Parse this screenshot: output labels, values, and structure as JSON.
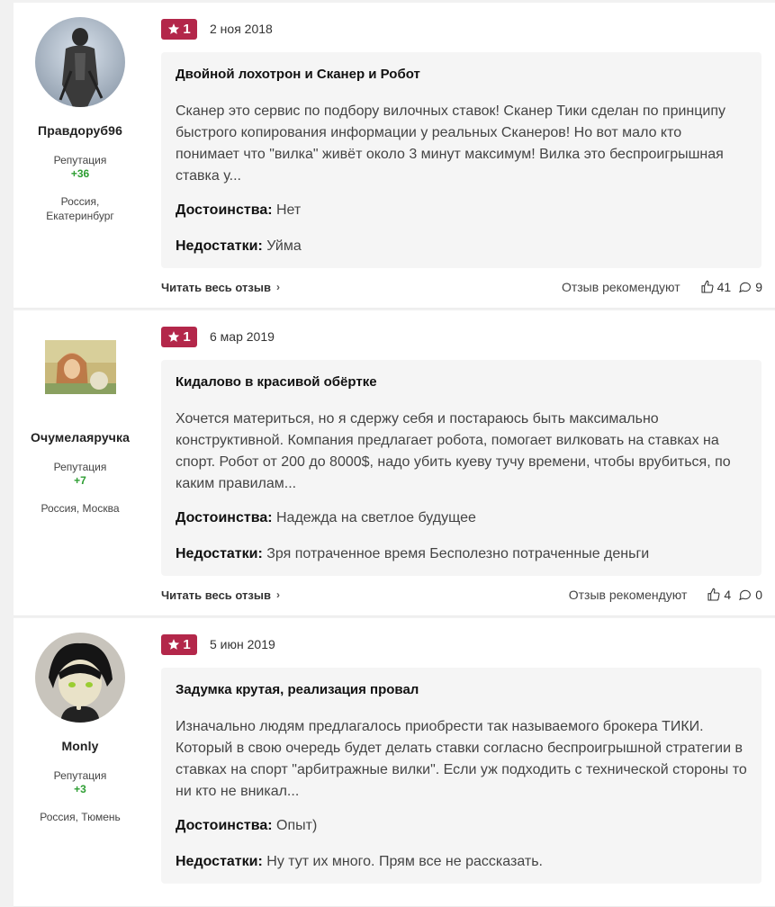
{
  "reviews": [
    {
      "username": "Правдоруб96",
      "reputation_label": "Репутация",
      "reputation_value": "+36",
      "location": "Россия, Екатеринбург",
      "rating": "1",
      "date": "2 ноя 2018",
      "title": "Двойной лохотрон и Сканер и Робот",
      "text": "Сканер это сервис по подбору вилочных ставок! Сканер Тики сделан по принципу быстрого копирования информации у реальных Сканеров! Но вот мало кто понимает что \"вилка\" живёт около 3 минут максимум! Вилка это беспроигрышная ставка у...",
      "pros_label": "Достоинства:",
      "pros": "Нет",
      "cons_label": "Недостатки:",
      "cons": "Уйма",
      "read_more": "Читать весь отзыв",
      "recommend_label": "Отзыв рекомендуют",
      "likes": "41",
      "comments": "9"
    },
    {
      "username": "Очумелаяручка",
      "reputation_label": "Репутация",
      "reputation_value": "+7",
      "location": "Россия, Москва",
      "rating": "1",
      "date": "6 мар 2019",
      "title": "Кидалово в красивой обёртке",
      "text": "Хочется материться, но я сдержу себя и постараюсь быть максимально конструктивной. Компания предлагает робота, помогает вилковать на ставках на спорт. Робот от 200 до 8000$, надо убить куеву тучу времени, чтобы врубиться, по каким правилам...",
      "pros_label": "Достоинства:",
      "pros": "Надежда на светлое будущее",
      "cons_label": "Недостатки:",
      "cons": "Зря потраченное время Бесполезно потраченные деньги",
      "read_more": "Читать весь отзыв",
      "recommend_label": "Отзыв рекомендуют",
      "likes": "4",
      "comments": "0"
    },
    {
      "username": "Monly",
      "reputation_label": "Репутация",
      "reputation_value": "+3",
      "location": "Россия, Тюмень",
      "rating": "1",
      "date": "5 июн 2019",
      "title": "Задумка крутая, реализация провал",
      "text": "Изначально людям предлагалось приобрести так называемого брокера ТИКИ. Который в свою очередь будет делать ставки согласно беспроигрышной стратегии в ставках на спорт \"арбитражные вилки\". Если уж подходить с технической стороны то ни кто не вникал...",
      "pros_label": "Достоинства:",
      "pros": "Опыт)",
      "cons_label": "Недостатки:",
      "cons": "Ну тут их много. Прям все не рассказать."
    }
  ],
  "colors": {
    "rating_badge": "#b3274a",
    "reputation": "#2e9e33",
    "card_bg": "#f5f5f5"
  }
}
